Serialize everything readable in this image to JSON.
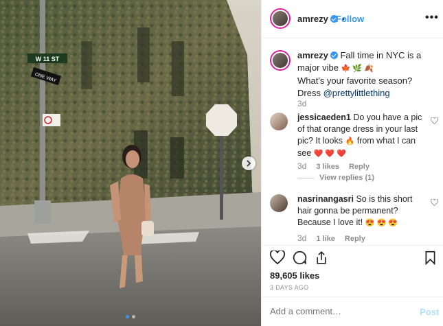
{
  "post": {
    "username": "amrezy",
    "follow_label": "Follow",
    "separator": "•",
    "more_label": "•••"
  },
  "caption": {
    "username": "amrezy",
    "line1": "Fall time in NYC is a major vibe",
    "line1_emojis": "🍁 🌿 🍂",
    "line2": "What's your favorite season?",
    "line3_prefix": "Dress",
    "mention": "@prettylittlething",
    "age": "3d"
  },
  "comments": [
    {
      "username": "jessicaeden1",
      "text_a": "Do you have a pic of that orange dress in your last pic? It looks",
      "emoji_a": "🔥",
      "text_b": "from what I can see",
      "emoji_b": "❤️ ❤️ ❤️",
      "age": "3d",
      "likes": "3 likes",
      "reply": "Reply",
      "view_replies": "View replies (1)"
    },
    {
      "username": "nasrinangasri",
      "text_a": "So is this short hair gonna be permanent? Because I love it!",
      "emoji_a": "😍 😍 😍",
      "age": "3d",
      "likes": "1 like",
      "reply": "Reply"
    }
  ],
  "likes_count": "89,605 likes",
  "posted_ago": "3 DAYS AGO",
  "comment_box": {
    "placeholder": "Add a comment…",
    "post_label": "Post"
  },
  "photo": {
    "street_sign_1": "W 11 ST",
    "street_sign_2": "ONE WAY",
    "carousel_count": 2,
    "carousel_active": 1
  },
  "colors": {
    "link_blue": "#3897f0",
    "mention_blue": "#003569",
    "meta_gray": "#8e8e8e",
    "post_disabled": "#b2dffc",
    "heart_red": "#ed4956"
  }
}
